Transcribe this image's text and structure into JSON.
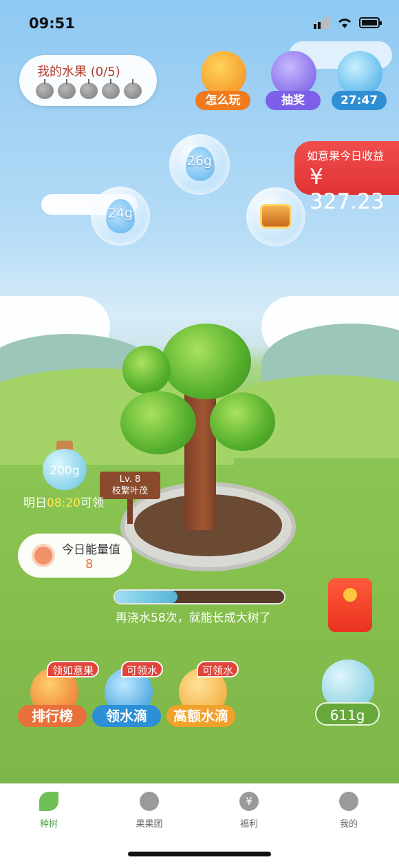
{
  "status": {
    "time": "09:51"
  },
  "fruit_card": {
    "title": "我的水果 (0/5)",
    "count": 5
  },
  "top_buttons": [
    {
      "label": "怎么玩"
    },
    {
      "label": "抽奖"
    },
    {
      "label": "27:47"
    }
  ],
  "earnings": {
    "label": "如意果今日收益",
    "value": "¥ 327.23"
  },
  "bubbles": [
    {
      "label": "26g"
    },
    {
      "label": "24g"
    }
  ],
  "tree": {
    "level": "Lv. 8",
    "stage": "枝繁叶茂"
  },
  "bottle": {
    "amount": "200g",
    "claim_prefix": "明日",
    "claim_time": "08:20",
    "claim_suffix": "可领"
  },
  "energy": {
    "label": "今日能量值",
    "value": "8"
  },
  "progress": {
    "fraction": 0.37,
    "text": "再浇水58次，就能长成大树了"
  },
  "actions": [
    {
      "badge": "领如意果",
      "label": "排行榜"
    },
    {
      "badge": "可领水",
      "label": "领水滴"
    },
    {
      "badge": "可领水",
      "label": "高额水滴"
    }
  ],
  "kettle": {
    "amount": "611g"
  },
  "tabs": [
    {
      "label": "种树",
      "active": true
    },
    {
      "label": "果果团",
      "active": false
    },
    {
      "label": "福利",
      "active": false
    },
    {
      "label": "我的",
      "active": false
    }
  ],
  "colors": {
    "accent_green": "#55a84a",
    "earnings_red": "#e03434",
    "progress_fill": "#55b5d8"
  }
}
